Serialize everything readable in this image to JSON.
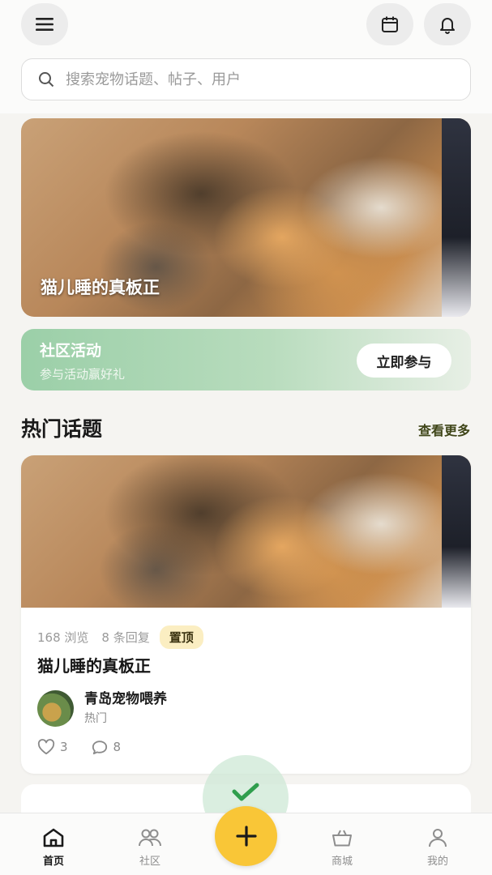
{
  "header": {
    "menu_icon": "hamburger-menu-icon",
    "calendar_icon": "calendar-icon",
    "bell_icon": "bell-icon"
  },
  "search": {
    "icon": "search-icon",
    "placeholder": "搜索宠物话题、帖子、用户"
  },
  "banner": {
    "title": "猫儿睡的真板正"
  },
  "activity": {
    "title": "社区活动",
    "subtitle": "参与活动赢好礼",
    "button_label": "立即参与"
  },
  "hot_topics": {
    "title": "热门话题",
    "see_more": "查看更多"
  },
  "post": {
    "views": "168 浏览",
    "replies": "8 条回复",
    "pin_badge": "置顶",
    "title": "猫儿睡的真板正",
    "author": "青岛宠物喂养",
    "author_tag": "热门",
    "likes": "3",
    "comments": "8"
  },
  "colors": {
    "accent_yellow": "#f9c637",
    "activity_green": "#9bcfa8",
    "pin_bg": "#fbeec2",
    "check_green": "#2f9e4d"
  },
  "tabbar": {
    "items": [
      {
        "label": "首页",
        "icon": "home-icon",
        "active": true
      },
      {
        "label": "社区",
        "icon": "community-icon",
        "active": false
      },
      {
        "label": "商城",
        "icon": "shop-basket-icon",
        "active": false
      },
      {
        "label": "我的",
        "icon": "profile-icon",
        "active": false
      }
    ],
    "fab_icon": "plus-icon"
  }
}
